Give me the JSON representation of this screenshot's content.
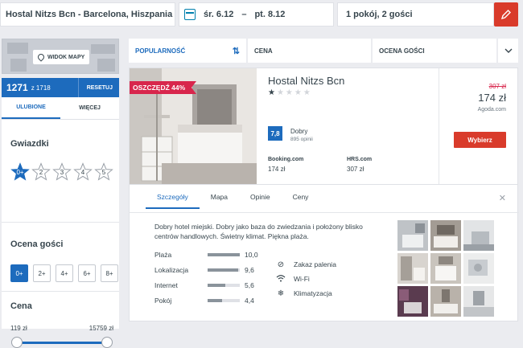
{
  "search": {
    "destination": "Hostal Nitzs Bcn - Barcelona, Hiszpania",
    "date_from": "śr. 6.12",
    "date_to": "pt. 8.12",
    "rooms": "1 pokój, 2 gości"
  },
  "sidebar": {
    "map_button": "WIDOK MAPY",
    "count": "1271",
    "count_total": "z 1718",
    "reset": "RESETUJ",
    "tabs": [
      "ULUBIONE",
      "WIĘCEJ"
    ],
    "stars_title": "Gwiazdki",
    "stars_options": [
      "0+",
      "2",
      "3",
      "4",
      "5"
    ],
    "rating_title": "Ocena gości",
    "rating_options": [
      "0+",
      "2+",
      "4+",
      "6+",
      "8+"
    ],
    "price_title": "Cena",
    "price_min": "119 zł",
    "price_max": "15759 zł"
  },
  "sort": {
    "options": [
      "POPULARNOŚĆ",
      "CENA",
      "OCENA GOŚCI"
    ]
  },
  "hotel": {
    "badge": "OSZCZĘDŹ 44%",
    "name": "Hostal Nitzs Bcn",
    "stars": 1,
    "score": "7,8",
    "score_label": "Dobry",
    "reviews": "895 opinii",
    "deals": [
      {
        "name": "Booking.com",
        "price": "174 zł"
      },
      {
        "name": "HRS.com",
        "price": "307 zł"
      }
    ],
    "old_price": "307 zł",
    "price": "174 zł",
    "provider": "Agoda.com",
    "choose": "Wybierz"
  },
  "details": {
    "tabs": [
      "Szczegóły",
      "Mapa",
      "Opinie",
      "Ceny"
    ],
    "description": "Dobry hotel miejski. Dobry jako baza do zwiedzania i położony blisko centrów handlowych. Świetny klimat. Piękna plaża.",
    "ratings": [
      {
        "label": "Plaża",
        "value": "10,0",
        "score": 10.0
      },
      {
        "label": "Lokalizacja",
        "value": "9,6",
        "score": 9.6
      },
      {
        "label": "Internet",
        "value": "5,6",
        "score": 5.6
      },
      {
        "label": "Pokój",
        "value": "4,4",
        "score": 4.4
      }
    ],
    "amenities": [
      {
        "icon": "no-smoking-icon",
        "label": "Zakaz palenia"
      },
      {
        "icon": "wifi-icon",
        "label": "Wi-Fi"
      },
      {
        "icon": "snowflake-icon",
        "label": "Klimatyzacja"
      }
    ]
  },
  "colors": {
    "accent": "#1d6bbd",
    "cta": "#d93b2b",
    "badge": "#d8264c"
  }
}
